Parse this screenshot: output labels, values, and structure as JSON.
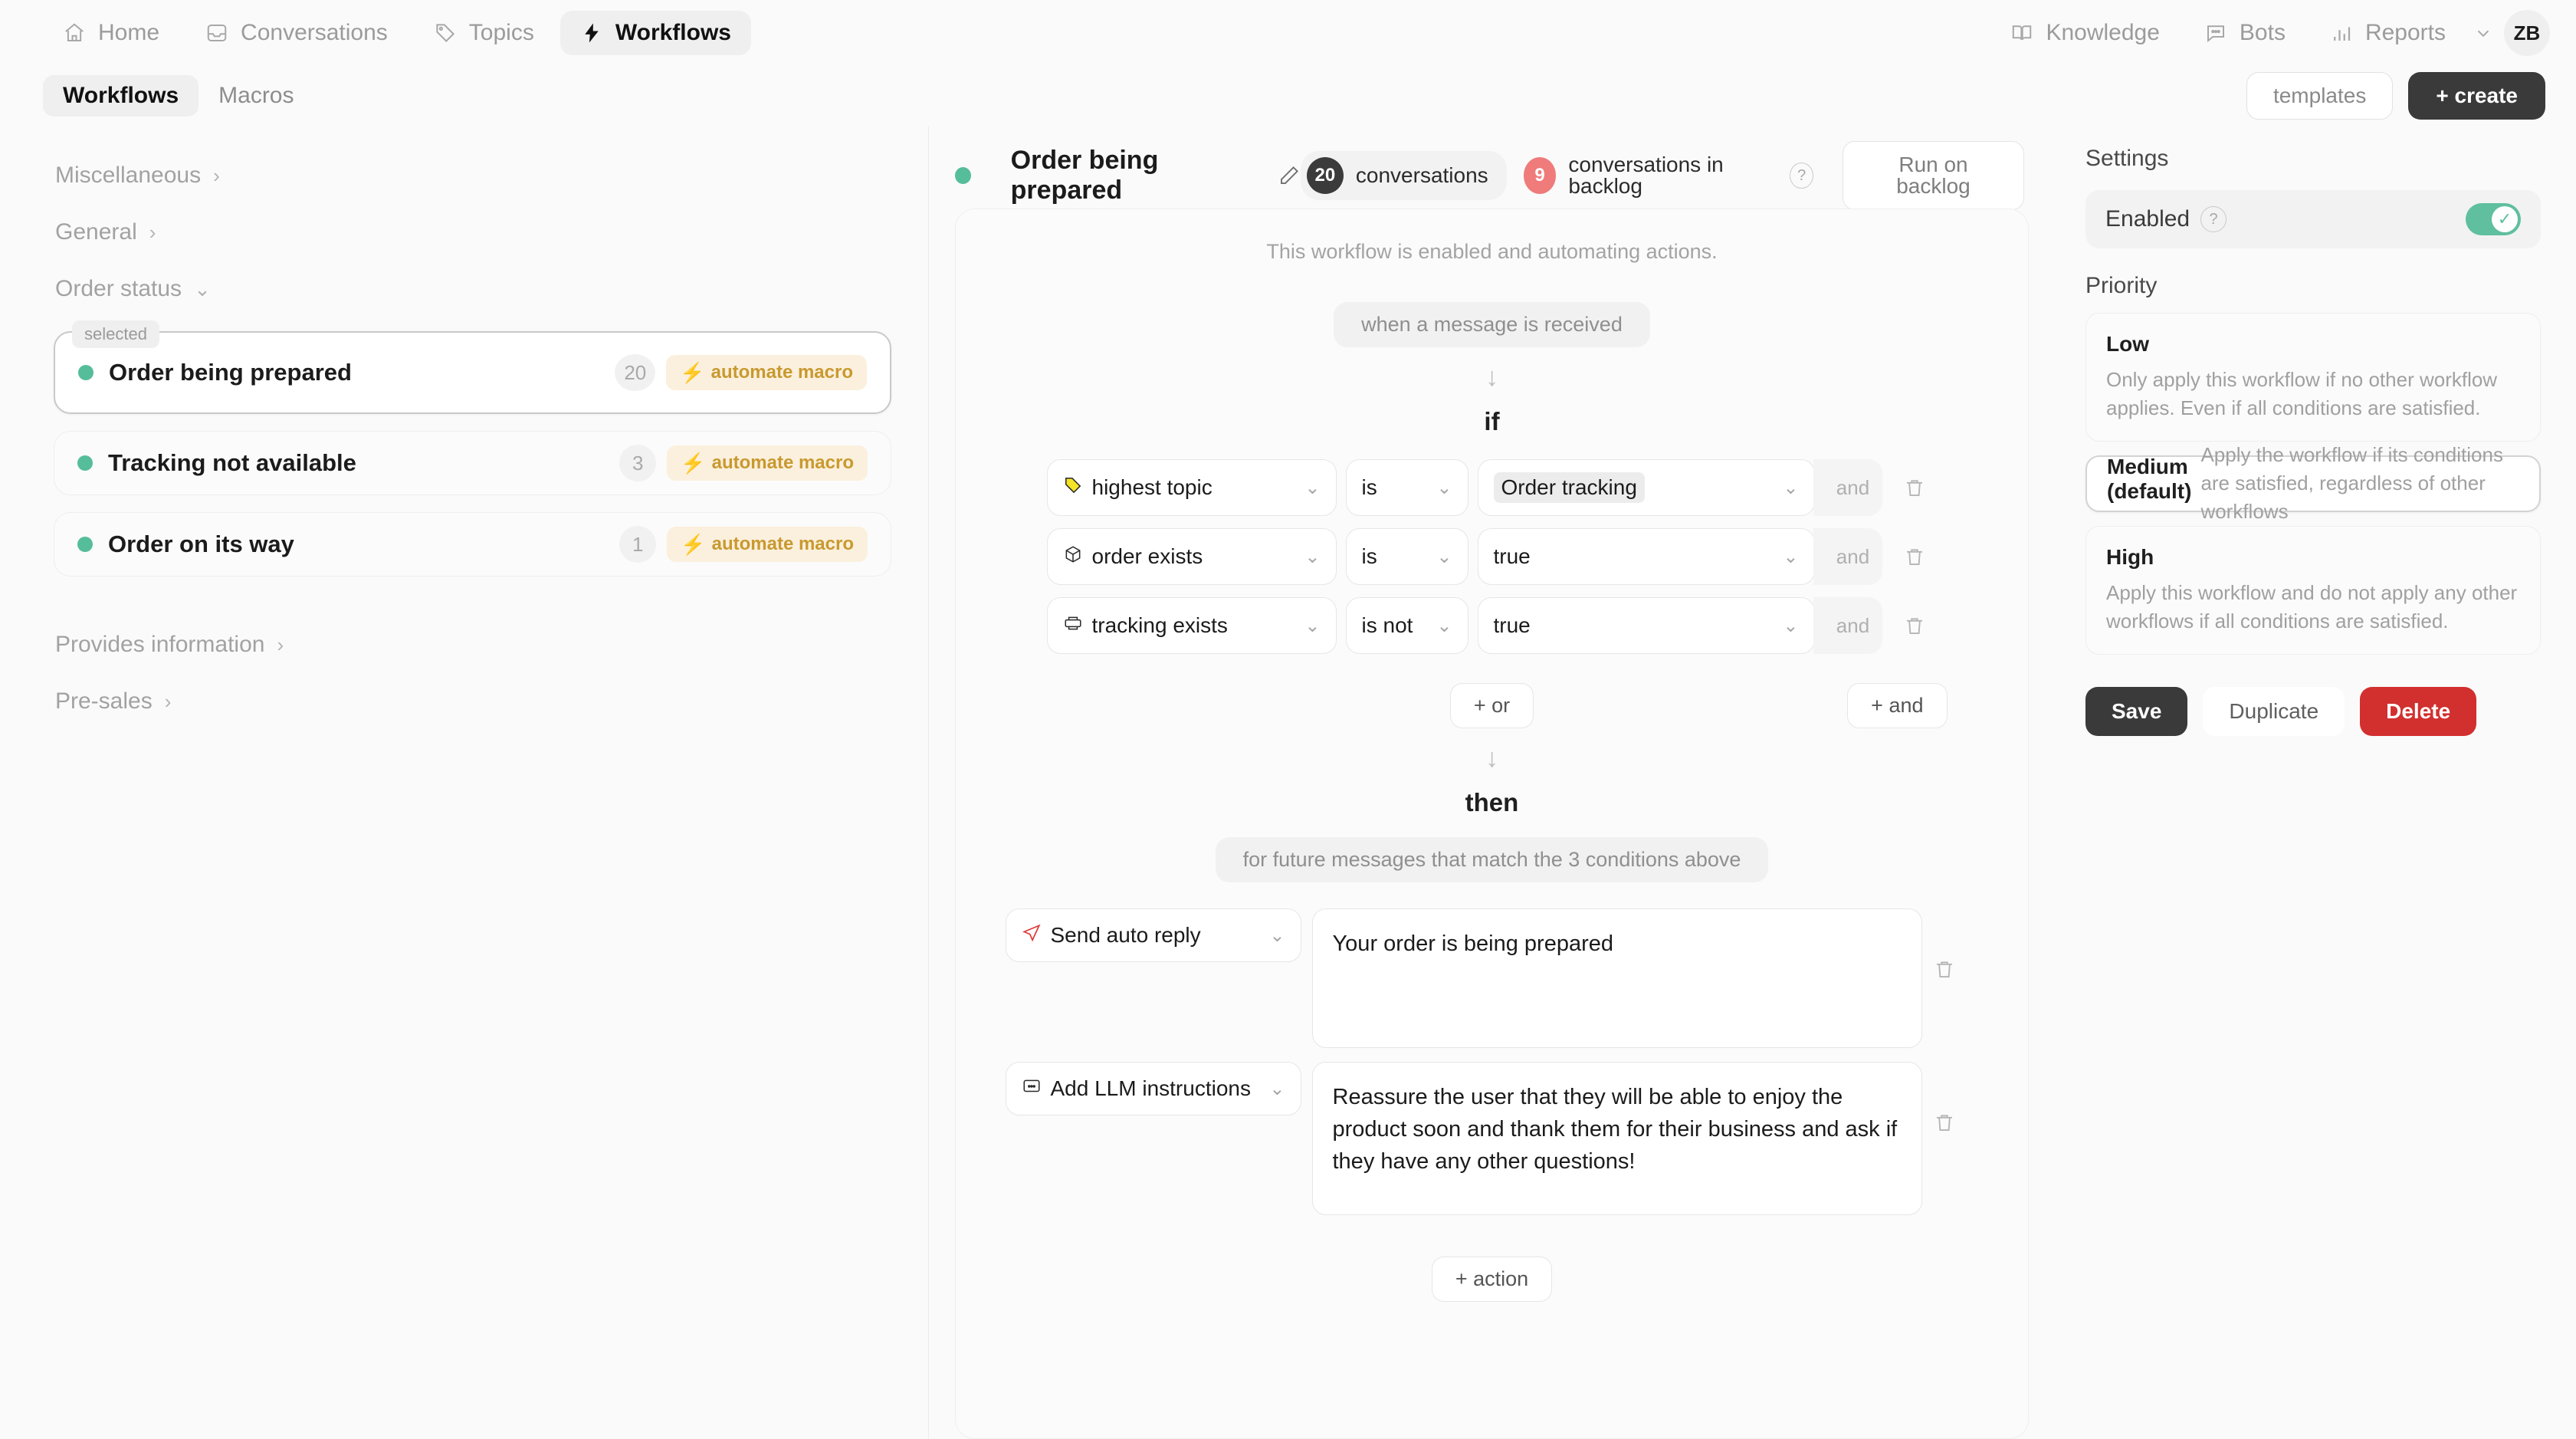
{
  "topnav": {
    "items": [
      {
        "label": "Home",
        "icon": "home-icon",
        "active": false
      },
      {
        "label": "Conversations",
        "icon": "inbox-icon",
        "active": false
      },
      {
        "label": "Topics",
        "icon": "tag-icon",
        "active": false
      },
      {
        "label": "Workflows",
        "icon": "bolt-icon",
        "active": true
      }
    ],
    "right_items": [
      {
        "label": "Knowledge",
        "icon": "book-icon"
      },
      {
        "label": "Bots",
        "icon": "chat-icon"
      },
      {
        "label": "Reports",
        "icon": "bar-chart-icon"
      }
    ],
    "avatar_initials": "ZB"
  },
  "subbar": {
    "tabs": [
      {
        "label": "Workflows",
        "active": true
      },
      {
        "label": "Macros",
        "active": false
      }
    ],
    "templates_label": "templates",
    "create_label": "+ create"
  },
  "sidebar": {
    "groups_top": [
      {
        "label": "Miscellaneous",
        "caret": "›"
      },
      {
        "label": "General",
        "caret": "›"
      },
      {
        "label": "Order status",
        "caret": "⌄"
      }
    ],
    "workflows": [
      {
        "name": "Order being prepared",
        "count": "20",
        "macro": "automate macro",
        "selected": true,
        "selected_badge": "selected"
      },
      {
        "name": "Tracking not available",
        "count": "3",
        "macro": "automate macro",
        "selected": false
      },
      {
        "name": "Order on its way",
        "count": "1",
        "macro": "automate macro",
        "selected": false
      }
    ],
    "groups_bottom": [
      {
        "label": "Provides information",
        "caret": "›"
      },
      {
        "label": "Pre-sales",
        "caret": "›"
      }
    ]
  },
  "workflow": {
    "title": "Order being prepared",
    "conversations_count": "20",
    "conversations_label": "conversations",
    "backlog_count": "9",
    "backlog_label": "conversations in backlog",
    "help_glyph": "?",
    "run_backlog_label": "Run on backlog",
    "enabled_note": "This workflow is enabled and automating actions.",
    "trigger_label": "when a message is received",
    "if_label": "if",
    "then_label": "then",
    "then_note": "for future messages that match the 3 conditions above",
    "or_label": "+ or",
    "and_label": "+ and",
    "add_action_label": "+ action",
    "conditions": [
      {
        "field": "highest topic",
        "field_icon": "tag-icon",
        "operator": "is",
        "value": "Order tracking",
        "value_highlight": true,
        "joiner": "and"
      },
      {
        "field": "order exists",
        "field_icon": "box-icon",
        "operator": "is",
        "value": "true",
        "value_highlight": false,
        "joiner": "and"
      },
      {
        "field": "tracking exists",
        "field_icon": "truck-icon",
        "operator": "is not",
        "value": "true",
        "value_highlight": false,
        "joiner": "and"
      }
    ],
    "actions": [
      {
        "type": "Send auto reply",
        "type_icon": "send-icon",
        "text": "Your order is being prepared"
      },
      {
        "type": "Add LLM instructions",
        "type_icon": "message-icon",
        "text": "Reassure the user that they will be able to enjoy the product soon and thank them for their business and ask if they have any other questions!"
      }
    ]
  },
  "settings": {
    "title": "Settings",
    "enabled_label": "Enabled",
    "enabled_help": "?",
    "enabled_value": true,
    "priority_title": "Priority",
    "priorities": [
      {
        "name": "Low",
        "desc": "Only apply this workflow if no other workflow applies. Even if all conditions are satisfied.",
        "selected": false
      },
      {
        "name": "Medium (default)",
        "desc": "Apply the workflow if its conditions are satisfied, regardless of other workflows",
        "selected": true
      },
      {
        "name": "High",
        "desc": "Apply this workflow and do not apply any other workflows if all conditions are satisfied.",
        "selected": false
      }
    ],
    "save_label": "Save",
    "duplicate_label": "Duplicate",
    "delete_label": "Delete"
  },
  "colors": {
    "accent_green": "#56bd9a",
    "danger_red": "#d22f2f",
    "badge_red": "#ef7b7b",
    "macro_amber": "#c9992f",
    "dark": "#3a3a3a"
  }
}
